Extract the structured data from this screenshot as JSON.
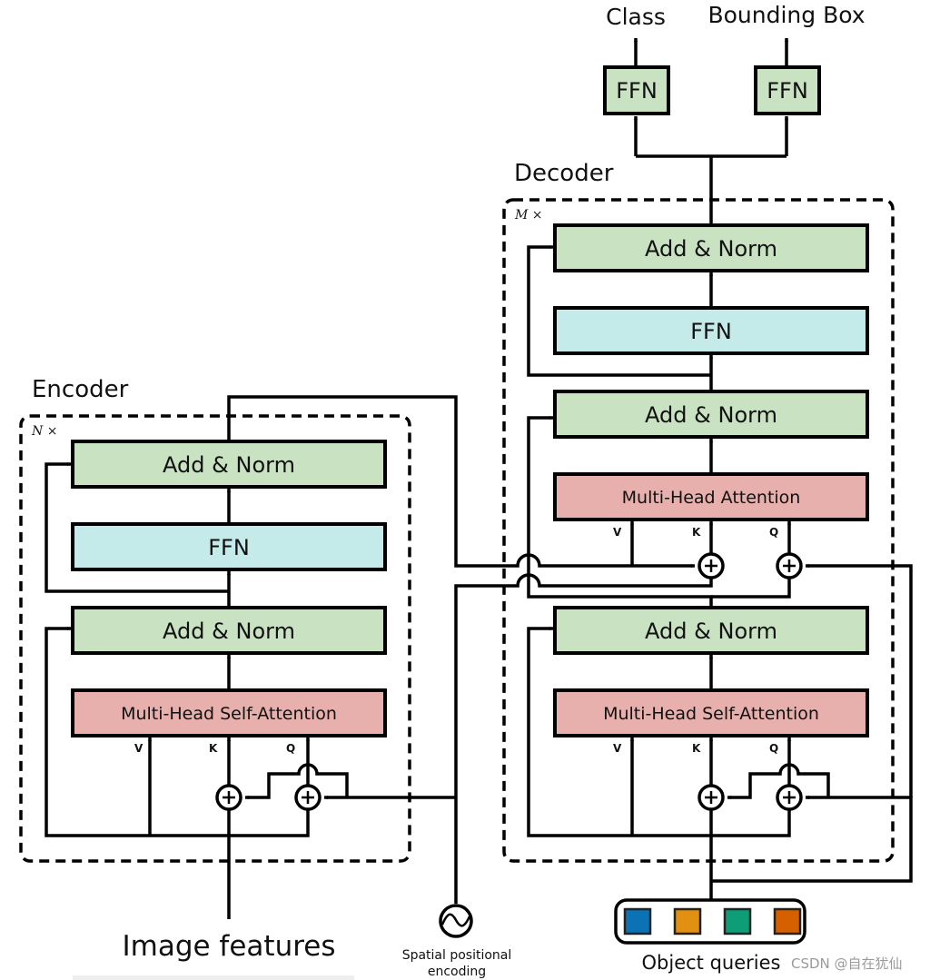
{
  "colors": {
    "add_norm": "#c9e2c2",
    "ffn": "#c5eaea",
    "attention": "#e8b0ad",
    "query_colors": [
      "#0b72b5",
      "#e19011",
      "#0d9e77",
      "#d65f00"
    ]
  },
  "outputs": {
    "class_label": "Class",
    "bbox_label": "Bounding Box",
    "class_ffn": "FFN",
    "bbox_ffn": "FFN"
  },
  "encoder": {
    "title": "Encoder",
    "repeat": "N ×",
    "add_norm_top": "Add & Norm",
    "ffn": "FFN",
    "add_norm_bottom": "Add & Norm",
    "self_attention": "Multi-Head  Self-Attention",
    "v": "V",
    "k": "K",
    "q": "Q",
    "input_label": "Image features"
  },
  "decoder": {
    "title": "Decoder",
    "repeat": "M ×",
    "add_norm_top": "Add & Norm",
    "ffn": "FFN",
    "add_norm_mid": "Add & Norm",
    "cross_attention": "Multi-Head  Attention",
    "add_norm_bottom": "Add & Norm",
    "self_attention": "Multi-Head  Self-Attention",
    "v": "V",
    "k": "K",
    "q": "Q",
    "input_label": "Object  queries"
  },
  "positional_encoding": {
    "line1": "Spatial  positional",
    "line2": "encoding"
  },
  "watermark": "CSDN @自在犹仙"
}
